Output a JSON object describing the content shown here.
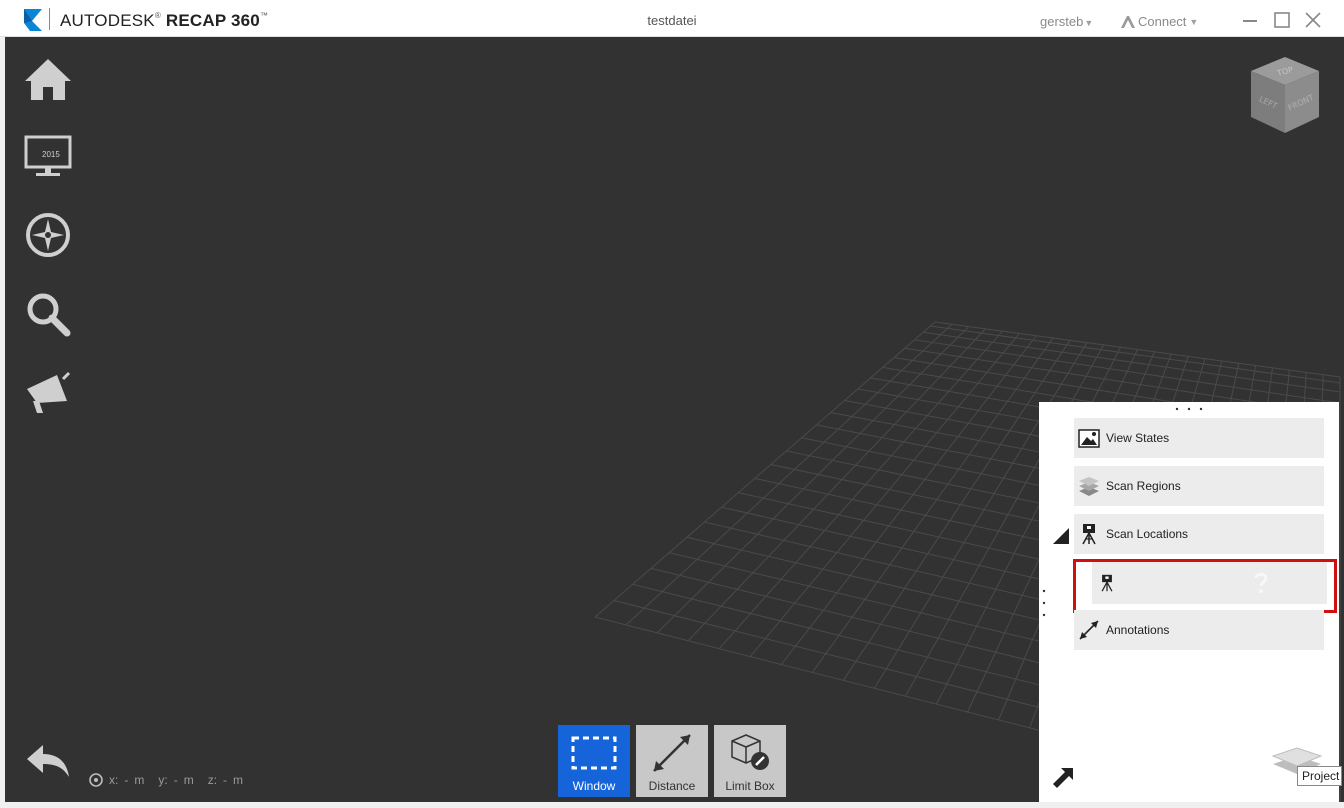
{
  "titlebar": {
    "brand": "AUTODESK",
    "brand_mark": "®",
    "product": "RECAP 360",
    "product_mark": "™",
    "document_title": "testdatei",
    "user": "gersteb",
    "connect": "Connect"
  },
  "left_tools": [
    {
      "name": "home-icon"
    },
    {
      "name": "monitor-icon",
      "badge": "2015"
    },
    {
      "name": "compass-icon"
    },
    {
      "name": "search-icon"
    },
    {
      "name": "megaphone-icon"
    }
  ],
  "coordinates": {
    "x_label": "x:",
    "x_value": "-",
    "x_unit": "m",
    "y_label": "y:",
    "y_value": "-",
    "y_unit": "m",
    "z_label": "z:",
    "z_value": "-",
    "z_unit": "m"
  },
  "viewcube": {
    "top": "TOP",
    "left": "LEFT",
    "front": "FRONT"
  },
  "bottom_toolbar": {
    "window": "Window",
    "distance": "Distance",
    "limit_box": "Limit Box"
  },
  "project_panel": {
    "items": [
      {
        "label": "View States",
        "icon": "image-icon"
      },
      {
        "label": "Scan Regions",
        "icon": "layers-icon"
      },
      {
        "label": "Scan Locations",
        "icon": "tripod-camera-icon"
      },
      {
        "label": "Annotations",
        "icon": "measure-arrow-icon"
      }
    ],
    "tooltip": "Project N"
  },
  "colors": {
    "viewport_bg": "#323232",
    "accent_blue": "#1664d9",
    "highlight_red": "#d01010"
  }
}
